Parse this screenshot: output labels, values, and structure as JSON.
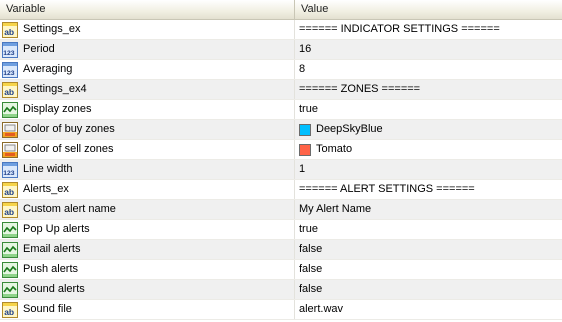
{
  "header": {
    "variable": "Variable",
    "value": "Value"
  },
  "rows": [
    {
      "name": "Settings_ex",
      "value": "====== INDICATOR SETTINGS ======",
      "icon": "string-icon"
    },
    {
      "name": "Period",
      "value": "16",
      "icon": "integer-icon"
    },
    {
      "name": "Averaging",
      "value": "8",
      "icon": "integer-icon"
    },
    {
      "name": "Settings_ex4",
      "value": "====== ZONES ======",
      "icon": "string-icon"
    },
    {
      "name": "Display zones",
      "value": "true",
      "icon": "boolean-icon"
    },
    {
      "name": "Color of buy zones",
      "value": "DeepSkyBlue",
      "icon": "color-icon",
      "swatch": "#00bfff"
    },
    {
      "name": "Color of sell zones",
      "value": "Tomato",
      "icon": "color-icon",
      "swatch": "#ff6347"
    },
    {
      "name": "Line width",
      "value": "1",
      "icon": "integer-icon"
    },
    {
      "name": "Alerts_ex",
      "value": "====== ALERT SETTINGS ======",
      "icon": "string-icon"
    },
    {
      "name": "Custom alert name",
      "value": "My Alert Name",
      "icon": "string-icon"
    },
    {
      "name": "Pop Up alerts",
      "value": "true",
      "icon": "boolean-icon"
    },
    {
      "name": "Email alerts",
      "value": "false",
      "icon": "boolean-icon"
    },
    {
      "name": "Push alerts",
      "value": "false",
      "icon": "boolean-icon"
    },
    {
      "name": "Sound alerts",
      "value": "false",
      "icon": "boolean-icon"
    },
    {
      "name": "Sound file",
      "value": "alert.wav",
      "icon": "string-icon"
    }
  ]
}
